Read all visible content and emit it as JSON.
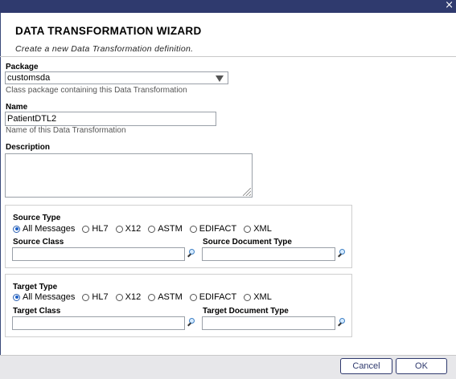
{
  "dialog": {
    "close_glyph": "×",
    "title": "DATA TRANSFORMATION WIZARD",
    "subtitle": "Create a new Data Transformation definition."
  },
  "package": {
    "label": "Package",
    "value": "customsda",
    "hint": "Class package containing this Data Transformation"
  },
  "name": {
    "label": "Name",
    "value": "PatientDTL2",
    "hint": "Name of this Data Transformation"
  },
  "description": {
    "label": "Description",
    "value": ""
  },
  "source": {
    "type_label": "Source Type",
    "options": [
      "All Messages",
      "HL7",
      "X12",
      "ASTM",
      "EDIFACT",
      "XML"
    ],
    "selected": "All Messages",
    "class_label": "Source Class",
    "class_value": "",
    "doctype_label": "Source Document Type",
    "doctype_value": ""
  },
  "target": {
    "type_label": "Target Type",
    "options": [
      "All Messages",
      "HL7",
      "X12",
      "ASTM",
      "EDIFACT",
      "XML"
    ],
    "selected": "All Messages",
    "class_label": "Target Class",
    "class_value": "",
    "doctype_label": "Target Document Type",
    "doctype_value": ""
  },
  "buttons": {
    "cancel": "Cancel",
    "ok": "OK"
  },
  "icons": [
    "close-icon",
    "dropdown-arrow-icon",
    "search-icon",
    "resize-grip-icon"
  ],
  "colors": {
    "titlebar": "#2f3a6e",
    "radio_selected": "#1a5fc8",
    "footer": "#e7e7ea"
  }
}
